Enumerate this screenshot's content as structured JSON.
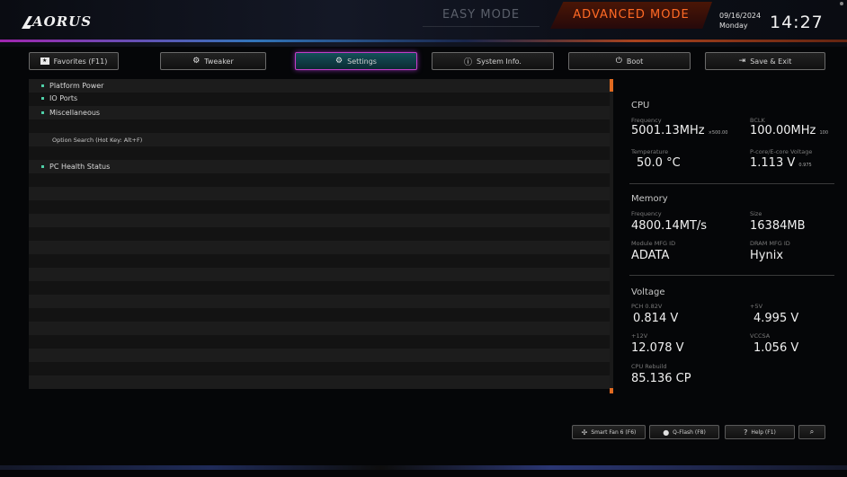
{
  "brand": {
    "logo_text": "AORUS"
  },
  "modes": {
    "easy": "EASY MODE",
    "advanced": "ADVANCED MODE"
  },
  "clock": {
    "date": "09/16/2024",
    "day": "Monday",
    "time": "14:27"
  },
  "tabs": [
    {
      "label": "Favorites (F11)",
      "icon": "star-box-icon"
    },
    {
      "label": "Tweaker",
      "icon": "tweaker-icon"
    },
    {
      "label": "Settings",
      "icon": "gear-icon",
      "active": true
    },
    {
      "label": "System Info.",
      "icon": "info-icon"
    },
    {
      "label": "Boot",
      "icon": "power-icon"
    },
    {
      "label": "Save & Exit",
      "icon": "exit-icon"
    }
  ],
  "menu": {
    "items": [
      "Platform Power",
      "IO Ports",
      "Miscellaneous"
    ],
    "search_hint": "Option Search (Hot Key: Alt+F)",
    "pc_health": "PC Health Status"
  },
  "cpu": {
    "title": "CPU",
    "frequency_label": "Frequency",
    "frequency": "5001.13MHz",
    "frequency_sub": "×500.00",
    "bclk_label": "BCLK",
    "bclk": "100.00MHz",
    "bclk_sub": "100",
    "temperature_label": "Temperature",
    "temperature": "50.0 °C",
    "vcore_label": "P-core/E-core Voltage",
    "vcore": "1.113 V",
    "vcore_sub": "0.975"
  },
  "memory": {
    "title": "Memory",
    "frequency_label": "Frequency",
    "frequency": "4800.14MT/s",
    "size_label": "Size",
    "size": "16384MB",
    "module_mfg_label": "Module MFG ID",
    "module_mfg": "ADATA",
    "dram_mfg_label": "DRAM MFG ID",
    "dram_mfg": "Hynix"
  },
  "voltage": {
    "title": "Voltage",
    "pch_label": "PCH 0.82V",
    "pch": "0.814 V",
    "v5_label": "+5V",
    "v5": "4.995 V",
    "v12_label": "+12V",
    "v12": "12.078 V",
    "vccsa_label": "VCCSA",
    "vccsa": "1.056 V",
    "cpu_rebuild_label": "CPU Rebuild",
    "cpu_rebuild": "85.136 CP"
  },
  "toolbar": {
    "smart_fan": "Smart Fan 6 (F6)",
    "qflash": "Q-Flash (F8)",
    "help": "Help (F1)"
  },
  "colors": {
    "accent_orange": "#ff6a25",
    "accent_purple": "#c33ec7",
    "bullet": "#4fd0a8"
  }
}
